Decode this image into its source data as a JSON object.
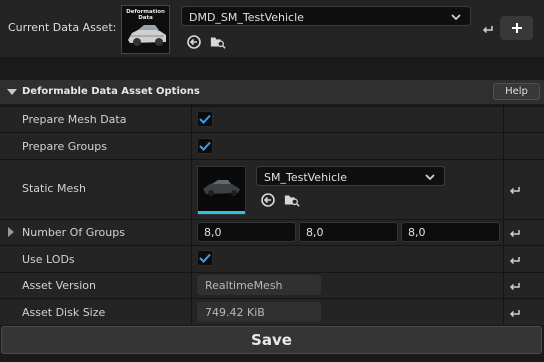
{
  "asset_picker": {
    "label": "Current Data Asset:",
    "thumbnail_text": "Deformation Data",
    "selected": "DMD_SM_TestVehicle"
  },
  "section": {
    "title": "Deformable Data Asset Options",
    "help_label": "Help"
  },
  "rows": {
    "prepare_mesh_data": {
      "label": "Prepare Mesh Data",
      "checked": true
    },
    "prepare_groups": {
      "label": "Prepare Groups",
      "checked": true
    },
    "static_mesh": {
      "label": "Static Mesh",
      "selected": "SM_TestVehicle"
    },
    "number_of_groups": {
      "label": "Number Of Groups",
      "values": [
        "8,0",
        "8,0",
        "8,0"
      ]
    },
    "use_lods": {
      "label": "Use LODs",
      "checked": true
    },
    "asset_version": {
      "label": "Asset Version",
      "value": "RealtimeMesh"
    },
    "asset_disk_size": {
      "label": "Asset Disk Size",
      "value": "749.42 KiB"
    }
  },
  "save_label": "Save",
  "icons": [
    "chevron-down-icon",
    "browse-arrow-icon",
    "folder-search-icon",
    "reset-arrow-icon",
    "plus-icon",
    "checkmark-icon",
    "collapse-arrow-icon",
    "expand-arrow-icon"
  ],
  "colors": {
    "accent_check": "#3d9cf0",
    "thumbnail_underline": "#27c4e6"
  }
}
